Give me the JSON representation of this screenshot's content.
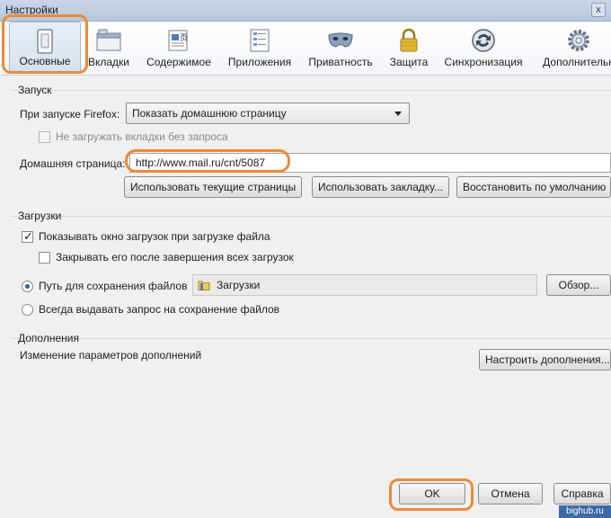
{
  "window": {
    "title": "Настройки",
    "close_glyph": "x"
  },
  "toolbar": {
    "tabs": [
      {
        "label": "Основные",
        "icon": "light-switch-icon"
      },
      {
        "label": "Вкладки",
        "icon": "tabs-window-icon"
      },
      {
        "label": "Содержимое",
        "icon": "document-content-icon"
      },
      {
        "label": "Приложения",
        "icon": "applications-list-icon"
      },
      {
        "label": "Приватность",
        "icon": "mask-icon"
      },
      {
        "label": "Защита",
        "icon": "padlock-icon"
      },
      {
        "label": "Синхронизация",
        "icon": "sync-icon"
      },
      {
        "label": "Дополнительн",
        "icon": "gear-icon"
      }
    ],
    "selected_tab": "Основные"
  },
  "startup": {
    "title": "Запуск",
    "when_starts_label": "При запуске Firefox:",
    "when_starts_value": "Показать домашнюю страницу",
    "dont_load_tabs_label": "Не загружать вкладки без запроса",
    "dont_load_tabs_checked": false,
    "homepage_label": "Домашняя страница:",
    "homepage_value": "http://www.mail.ru/cnt/5087",
    "use_current_pages": "Использовать текущие страницы",
    "use_bookmark": "Использовать закладку...",
    "restore_default": "Восстановить по умолчанию"
  },
  "downloads": {
    "title": "Загрузки",
    "show_window_label": "Показывать окно загрузок при загрузке файла",
    "show_window_checked": true,
    "close_when_done_label": "Закрывать его после завершения всех загрузок",
    "close_when_done_checked": false,
    "save_path_label": "Путь для сохранения файлов",
    "save_path_value": "Загрузки",
    "browse_button": "Обзор...",
    "always_ask_label": "Всегда выдавать запрос на сохранение файлов",
    "selected_option": "save_path"
  },
  "addons": {
    "title": "Дополнения",
    "description": "Изменение параметров дополнений",
    "manage_button": "Настроить дополнения..."
  },
  "footer": {
    "ok": "OK",
    "cancel": "Отмена",
    "help": "Справка"
  },
  "watermark": "bighub.ru",
  "colors": {
    "highlight": "#ec8a3a",
    "accent": "#2a5fa8"
  }
}
